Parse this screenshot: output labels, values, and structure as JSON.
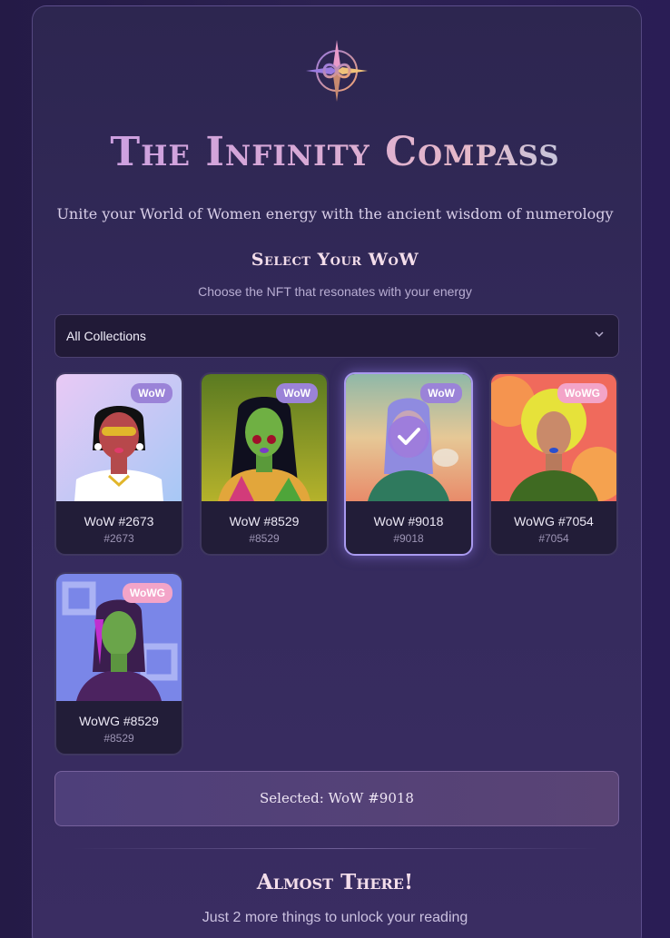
{
  "header": {
    "logo_icon": "infinity-compass-icon",
    "title": "The Infinity Compass",
    "subtitle": "Unite your World of Women energy with the ancient wisdom of numerology"
  },
  "select_section": {
    "title": "Select Your WoW",
    "subtitle": "Choose the NFT that resonates with your energy",
    "collection_filter": {
      "selected": "All Collections",
      "icon": "chevron-down-icon"
    }
  },
  "nfts": [
    {
      "badge": "WoW",
      "name": "WoW #2673",
      "number": "#2673",
      "selected": false
    },
    {
      "badge": "WoW",
      "name": "WoW #8529",
      "number": "#8529",
      "selected": false
    },
    {
      "badge": "WoW",
      "name": "WoW #9018",
      "number": "#9018",
      "selected": true
    },
    {
      "badge": "WoWG",
      "name": "WoWG #7054",
      "number": "#7054",
      "selected": false
    },
    {
      "badge": "WoWG",
      "name": "WoWG #8529",
      "number": "#8529",
      "selected": false
    }
  ],
  "selection": {
    "text": "Selected: WoW #9018"
  },
  "next_step": {
    "title": "Almost There!",
    "subtitle": "Just 2 more things to unlock your reading"
  },
  "colors": {
    "accent": "#9b83d8",
    "wowg_badge": "#f3a4c8",
    "selected_border": "#a99aef"
  }
}
